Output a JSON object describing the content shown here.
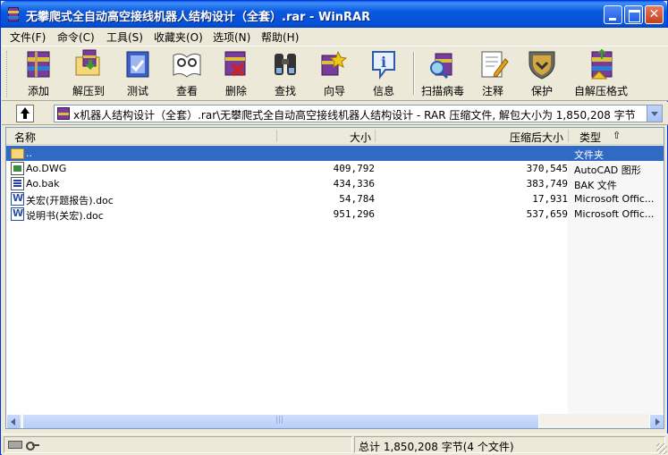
{
  "window": {
    "title": "无攀爬式全自动高空接线机器人结构设计（全套）.rar - WinRAR"
  },
  "menu": [
    {
      "label": "文件(F)"
    },
    {
      "label": "命令(C)"
    },
    {
      "label": "工具(S)"
    },
    {
      "label": "收藏夹(O)"
    },
    {
      "label": "选项(N)"
    },
    {
      "label": "帮助(H)"
    }
  ],
  "toolbar": [
    {
      "label": "添加",
      "icon": "add-archive-icon"
    },
    {
      "label": "解压到",
      "icon": "extract-to-icon"
    },
    {
      "label": "测试",
      "icon": "test-icon"
    },
    {
      "label": "查看",
      "icon": "view-icon"
    },
    {
      "label": "删除",
      "icon": "delete-icon"
    },
    {
      "label": "查找",
      "icon": "find-icon"
    },
    {
      "label": "向导",
      "icon": "wizard-icon"
    },
    {
      "label": "信息",
      "icon": "info-icon"
    },
    {
      "label": "扫描病毒",
      "icon": "virus-scan-icon"
    },
    {
      "label": "注释",
      "icon": "comment-icon"
    },
    {
      "label": "保护",
      "icon": "protect-icon"
    },
    {
      "label": "自解压格式",
      "icon": "sfx-icon"
    }
  ],
  "address": {
    "path": "x机器人结构设计（全套）.rar\\无攀爬式全自动高空接线机器人结构设计 - RAR 压缩文件, 解包大小为 1,850,208 字节"
  },
  "columns": {
    "name": "名称",
    "size": "大小",
    "packed": "压缩后大小",
    "type": "类型"
  },
  "files": [
    {
      "name": "..",
      "size": "",
      "packed": "",
      "type": "文件夹",
      "icon": "folder-icon",
      "selected": true
    },
    {
      "name": "Ao.DWG",
      "size": "409,792",
      "packed": "370,545",
      "type": "AutoCAD 图形",
      "icon": "dwg-file-icon",
      "selected": false
    },
    {
      "name": "Ao.bak",
      "size": "434,336",
      "packed": "383,749",
      "type": "BAK 文件",
      "icon": "bak-file-icon",
      "selected": false
    },
    {
      "name": "关宏(开题报告).doc",
      "size": "54,784",
      "packed": "17,931",
      "type": "Microsoft Offic...",
      "icon": "word-doc-icon",
      "selected": false
    },
    {
      "name": "说明书(关宏).doc",
      "size": "951,296",
      "packed": "537,659",
      "type": "Microsoft Offic...",
      "icon": "word-doc-icon",
      "selected": false
    }
  ],
  "status": {
    "summary": "总计 1,850,208 字节(4 个文件)"
  },
  "colors": {
    "titlebar": "#0a58e0",
    "selection": "#316ac5",
    "window_bg": "#ece9d8"
  }
}
